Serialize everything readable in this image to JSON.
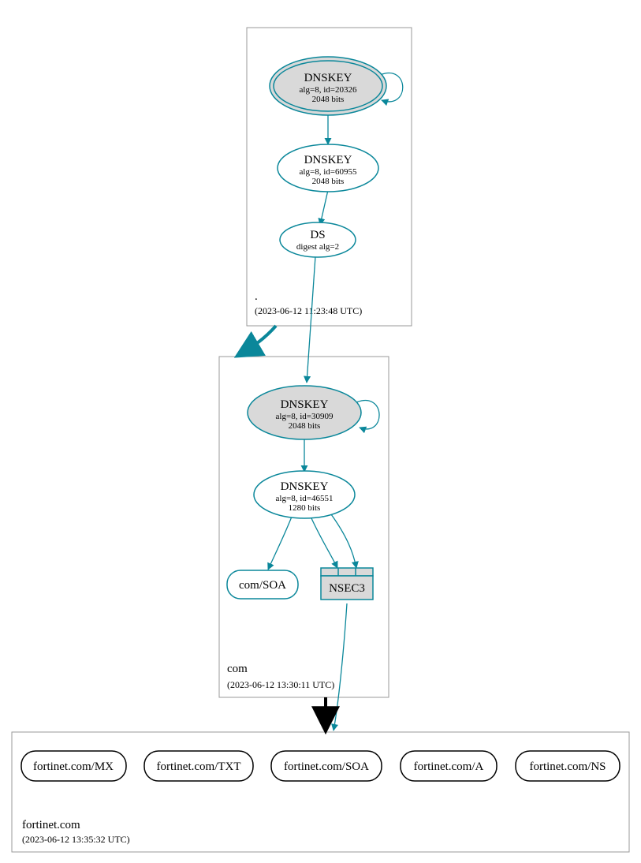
{
  "zones": {
    "root": {
      "label": ".",
      "timestamp": "(2023-06-12 11:23:48 UTC)"
    },
    "com": {
      "label": "com",
      "timestamp": "(2023-06-12 13:30:11 UTC)"
    },
    "fortinet": {
      "label": "fortinet.com",
      "timestamp": "(2023-06-12 13:35:32 UTC)"
    }
  },
  "nodes": {
    "root_ksk": {
      "title": "DNSKEY",
      "line1": "alg=8, id=20326",
      "line2": "2048 bits"
    },
    "root_zsk": {
      "title": "DNSKEY",
      "line1": "alg=8, id=60955",
      "line2": "2048 bits"
    },
    "root_ds": {
      "title": "DS",
      "line1": "digest alg=2"
    },
    "com_ksk": {
      "title": "DNSKEY",
      "line1": "alg=8, id=30909",
      "line2": "2048 bits"
    },
    "com_zsk": {
      "title": "DNSKEY",
      "line1": "alg=8, id=46551",
      "line2": "1280 bits"
    },
    "com_soa": {
      "title": "com/SOA"
    },
    "com_nsec3": {
      "title": "NSEC3"
    },
    "leaf_mx": {
      "title": "fortinet.com/MX"
    },
    "leaf_txt": {
      "title": "fortinet.com/TXT"
    },
    "leaf_soa": {
      "title": "fortinet.com/SOA"
    },
    "leaf_a": {
      "title": "fortinet.com/A"
    },
    "leaf_ns": {
      "title": "fortinet.com/NS"
    }
  },
  "colors": {
    "teal": "#0a879a",
    "grayfill": "#d9d9d9"
  }
}
